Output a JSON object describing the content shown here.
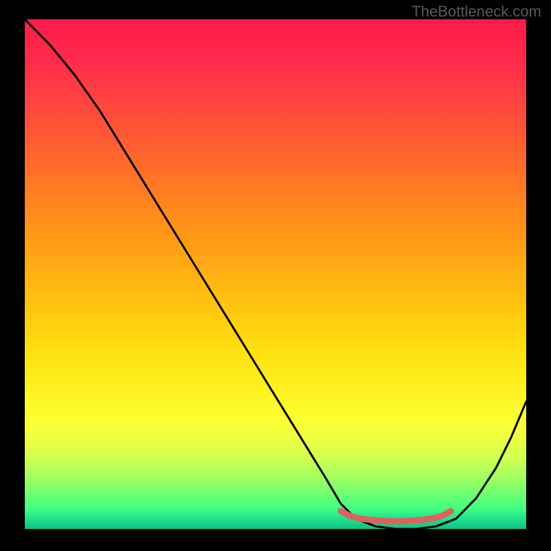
{
  "watermark": "TheBottleneck.com",
  "chart_data": {
    "type": "line",
    "title": "",
    "xlabel": "",
    "ylabel": "",
    "xlim": [
      0,
      100
    ],
    "ylim": [
      0,
      100
    ],
    "grid": false,
    "annotations": [],
    "series": [
      {
        "name": "black-curve",
        "color": "#000000",
        "x": [
          0,
          5,
          10,
          15,
          20,
          25,
          30,
          35,
          40,
          45,
          50,
          55,
          60,
          63,
          66,
          70,
          74,
          78,
          82,
          86,
          90,
          94,
          97,
          100
        ],
        "y": [
          100,
          95,
          89,
          82,
          74,
          66,
          58,
          50,
          42,
          34,
          26,
          18,
          10,
          5,
          2,
          0.5,
          0,
          0,
          0.5,
          2,
          6,
          12,
          18,
          25
        ]
      },
      {
        "name": "red-flat-segment",
        "color": "#e06060",
        "x": [
          63,
          65,
          67,
          69,
          71,
          73,
          75,
          77,
          79,
          81,
          83,
          85
        ],
        "y": [
          3.5,
          2.5,
          2,
          1.8,
          1.6,
          1.5,
          1.5,
          1.6,
          1.8,
          2,
          2.5,
          3.5
        ]
      }
    ],
    "background_gradient": {
      "direction": "vertical",
      "stops": [
        {
          "pos": 0.0,
          "color": "#ff1a4a"
        },
        {
          "pos": 0.15,
          "color": "#ff4040"
        },
        {
          "pos": 0.35,
          "color": "#ff8020"
        },
        {
          "pos": 0.55,
          "color": "#ffc010"
        },
        {
          "pos": 0.72,
          "color": "#fff020"
        },
        {
          "pos": 0.86,
          "color": "#d0ff50"
        },
        {
          "pos": 0.96,
          "color": "#40ff80"
        },
        {
          "pos": 1.0,
          "color": "#10c080"
        }
      ]
    }
  }
}
